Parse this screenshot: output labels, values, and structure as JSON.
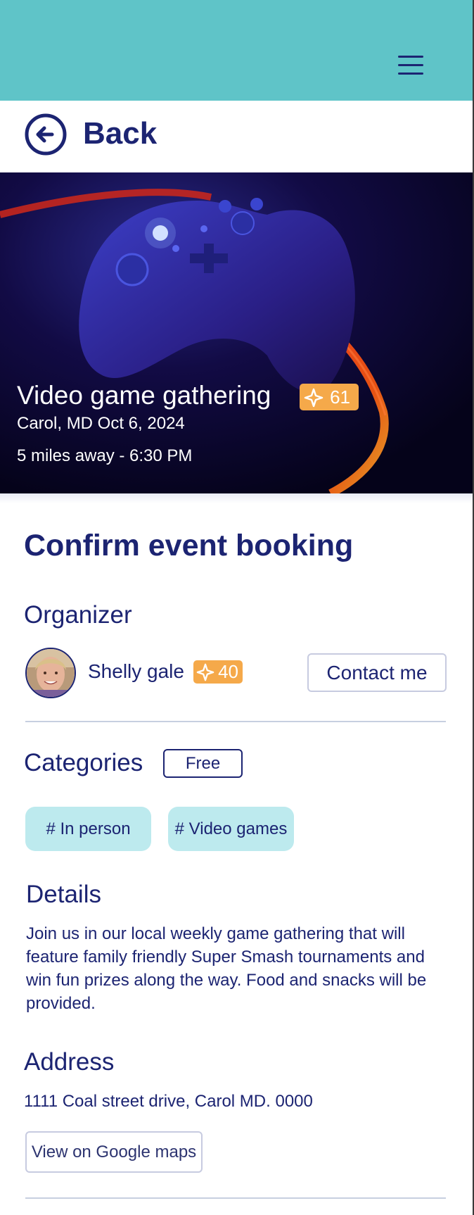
{
  "header": {
    "menu_icon": "hamburger-menu-icon",
    "back_icon": "arrow-left-circle-icon",
    "back_label": "Back",
    "accent_color": "#5fc4c8",
    "primary_color": "#1c2472"
  },
  "event": {
    "title": "Video game gathering",
    "points": "61",
    "points_icon": "sparkle-icon",
    "points_color": "#f5a94a",
    "location_date": "Carol, MD Oct 6, 2024",
    "distance_time": "5 miles away - 6:30 PM"
  },
  "page": {
    "heading": "Confirm event booking"
  },
  "organizer": {
    "heading": "Organizer",
    "name": "Shelly gale",
    "points": "40",
    "contact_label": "Contact me"
  },
  "categories": {
    "heading": "Categories",
    "price_badge": "Free",
    "tags": [
      "# In person",
      "# Video games"
    ]
  },
  "details": {
    "heading": "Details",
    "text": "Join us in our local weekly game gathering that will feature family friendly Super Smash tournaments and win fun prizes along the way. Food and snacks will be provided."
  },
  "address": {
    "heading": "Address",
    "text": "1111 Coal street drive, Carol MD. 0000",
    "maps_label": "View on Google maps"
  }
}
